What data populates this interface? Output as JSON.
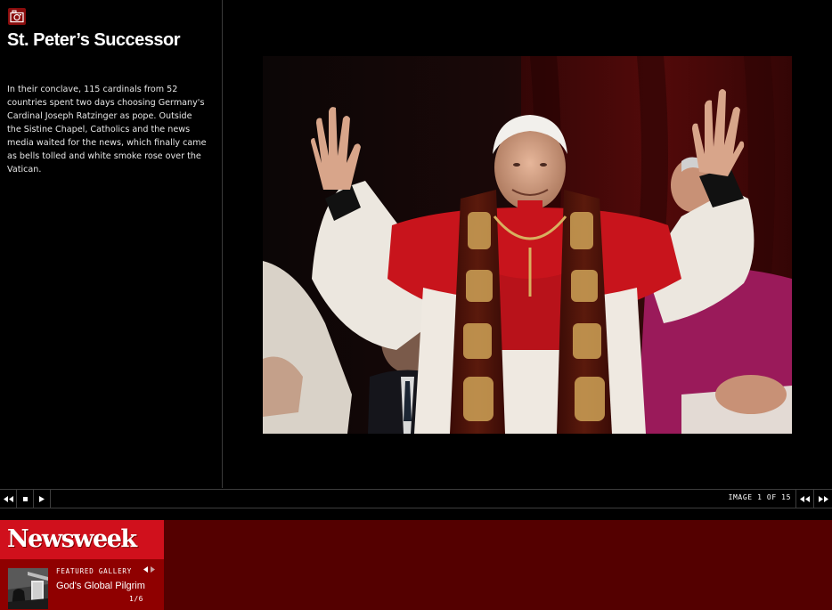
{
  "gallery": {
    "title": "St. Peter’s Successor",
    "description": "In their conclave, 115 cardinals from 52 countries spent two days choosing Germany's Cardinal Joseph Ratzinger as pope. Outside the Sistine Chapel, Catholics and the news media waited for the news, which finally came as bells tolled and white smoke rose over the Vatican.",
    "icon": "camera-icon"
  },
  "controls": {
    "counter": "IMAGE 1 OF 15",
    "current": 1,
    "total": 15,
    "icons": [
      "rewind-icon",
      "stop-icon",
      "play-icon",
      "previous-icon",
      "next-icon"
    ]
  },
  "footer": {
    "brand": "Newsweek",
    "featured_label": "FEATURED GALLERY",
    "gallery_title": "God's Global Pilgrim",
    "gallery_count": "1/6"
  },
  "colors": {
    "background": "#000000",
    "footer": "#540000",
    "brand_red": "#d0101c",
    "featured_bg": "#8f0000"
  }
}
